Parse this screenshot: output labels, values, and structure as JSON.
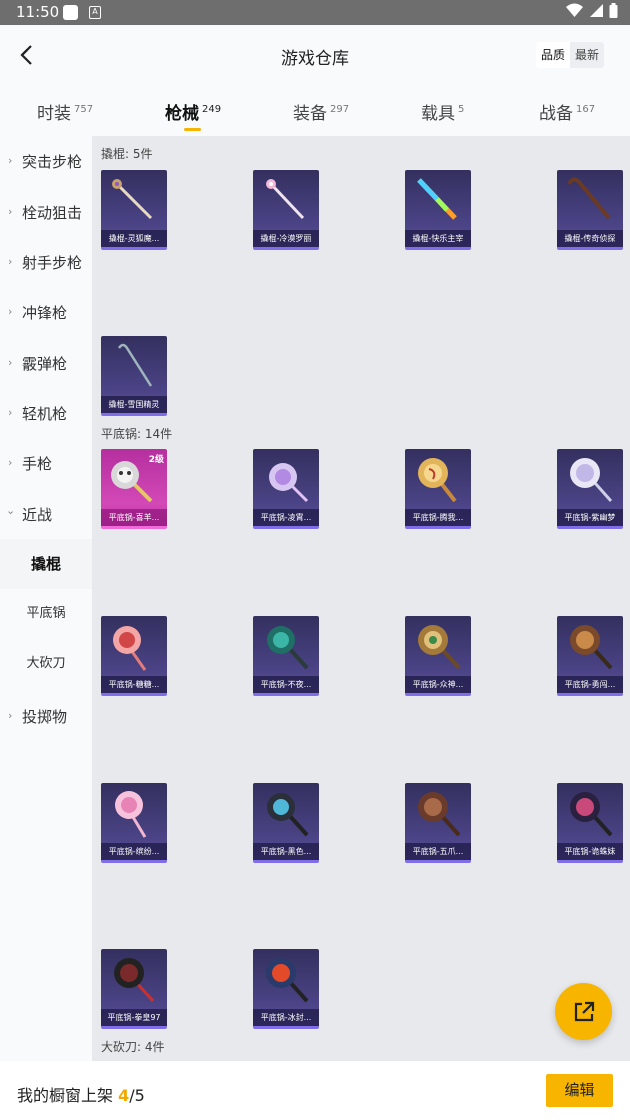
{
  "status": {
    "time": "11:50",
    "icon2": "A"
  },
  "header": {
    "title": "游戏仓库",
    "sort_quality": "品质",
    "sort_newest": "最新"
  },
  "tabs": [
    {
      "label": "时装",
      "count": "757"
    },
    {
      "label": "枪械",
      "count": "249"
    },
    {
      "label": "装备",
      "count": "297"
    },
    {
      "label": "载具",
      "count": "5"
    },
    {
      "label": "战备",
      "count": "167"
    }
  ],
  "sidebar": {
    "categories": [
      "突击步枪",
      "栓动狙击",
      "射手步枪",
      "冲锋枪",
      "霰弹枪",
      "轻机枪",
      "手枪",
      "近战"
    ],
    "sub": [
      "撬棍",
      "平底锅",
      "大砍刀"
    ],
    "last": "投掷物"
  },
  "sections": {
    "crowbar": "撬棍: 5件",
    "pan": "平底锅: 14件",
    "machete": "大砍刀: 4件"
  },
  "crowbar_items": [
    "撬棍-灵狐魔...",
    "撬棍-冷漠罗丽",
    "撬棍-快乐主宰",
    "撬棍-传奇侦探",
    "撬棍-雪国精灵"
  ],
  "pan_items": [
    "平底锅-喜羊...",
    "平底锅-凌霄...",
    "平底锅-腾我...",
    "平底锅-紫幽梦",
    "平底锅-糖糖...",
    "平底锅-不夜...",
    "平底锅-众神...",
    "平底锅-勇闯...",
    "平底锅-缤纷...",
    "平底锅-黑色...",
    "平底锅-五爪...",
    "平底锅-诡蛛妹",
    "平底锅-拳皇97",
    "平底锅-冰封..."
  ],
  "pan_level_badge": "2级",
  "bottom": {
    "label": "我的橱窗上架 ",
    "current": "4",
    "sep": "/",
    "total": "5",
    "edit": "编辑"
  }
}
